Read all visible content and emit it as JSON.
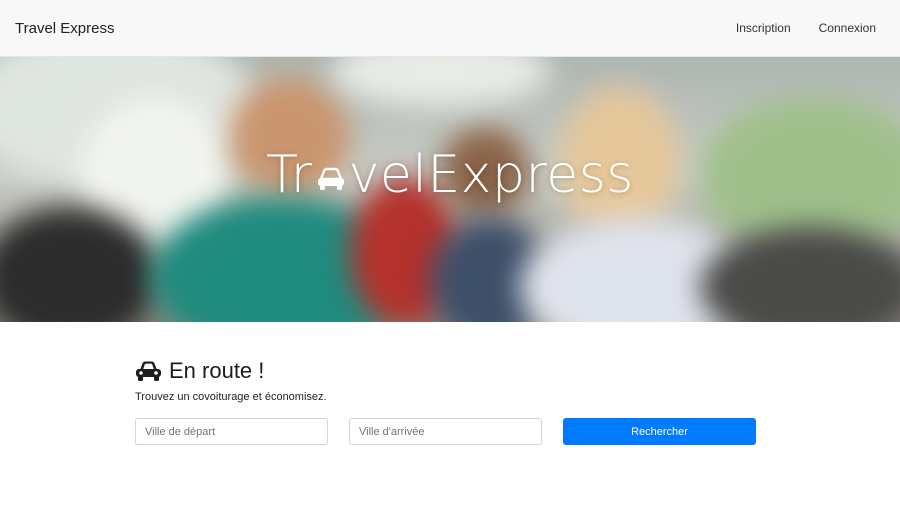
{
  "navbar": {
    "brand": "Travel Express",
    "links": [
      "Inscription",
      "Connexion"
    ]
  },
  "hero": {
    "logo_text_before": "Tr",
    "logo_text_after": "velExpress",
    "logo_car_icon": "car-icon"
  },
  "main": {
    "heading_icon": "car-icon",
    "heading": "En route !",
    "subtitle": "Trouvez un covoiturage et économisez.",
    "departure_placeholder": "Ville de départ",
    "arrival_placeholder": "Ville d'arrivée",
    "search_label": "Rechercher"
  },
  "colors": {
    "primary": "#007bff",
    "navbar_bg": "#f8f8f8"
  }
}
